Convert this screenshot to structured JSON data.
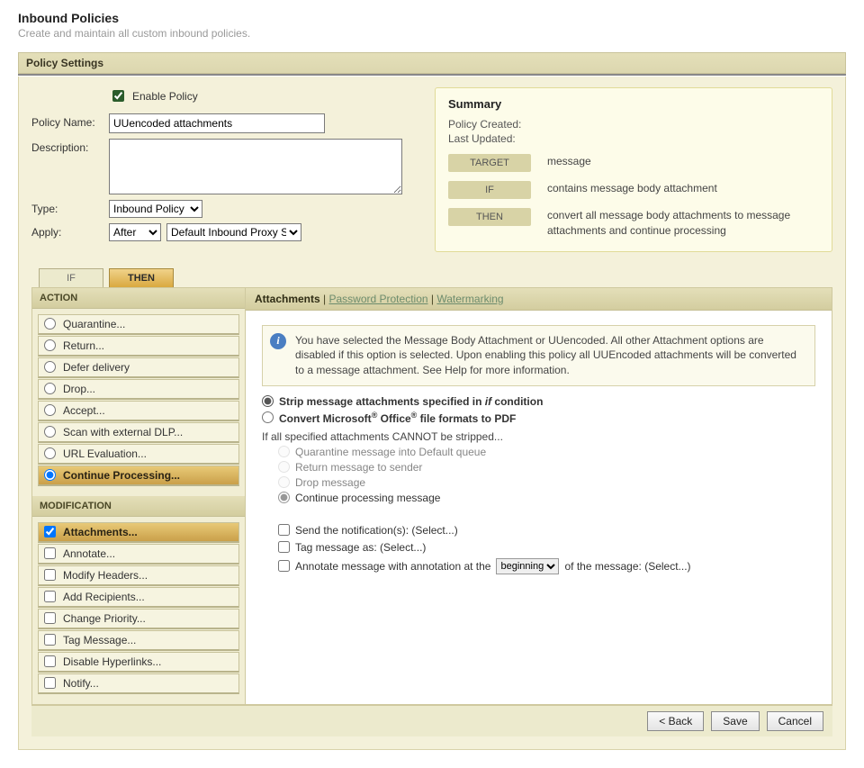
{
  "header": {
    "title": "Inbound Policies",
    "subtitle": "Create and maintain all custom inbound policies."
  },
  "settings": {
    "section_title": "Policy Settings",
    "enable_label": "Enable Policy",
    "enable_checked": true,
    "policy_name_label": "Policy Name:",
    "policy_name_value": "UUencoded attachments",
    "description_label": "Description:",
    "description_value": "",
    "type_label": "Type:",
    "type_options": [
      "Inbound Policy"
    ],
    "type_value": "Inbound Policy",
    "apply_label": "Apply:",
    "apply_when_value": "After",
    "apply_to_value": "Default Inbound Proxy S/M"
  },
  "summary": {
    "title": "Summary",
    "created_label": "Policy Created:",
    "updated_label": "Last Updated:",
    "target_pill": "TARGET",
    "target_value": "message",
    "if_pill": "IF",
    "if_value": "contains message body attachment",
    "then_pill": "THEN",
    "then_value": "convert all message body attachments to message attachments and continue processing"
  },
  "tabs": {
    "if": "IF",
    "then": "THEN"
  },
  "side": {
    "action_header": "ACTION",
    "mod_header": "MODIFICATION",
    "actions": [
      {
        "label": "Quarantine..."
      },
      {
        "label": "Return..."
      },
      {
        "label": "Defer delivery"
      },
      {
        "label": "Drop..."
      },
      {
        "label": "Accept..."
      },
      {
        "label": "Scan with external DLP..."
      },
      {
        "label": "URL Evaluation..."
      },
      {
        "label": "Continue Processing...",
        "selected": true
      }
    ],
    "mods": [
      {
        "label": "Attachments...",
        "selected": true
      },
      {
        "label": "Annotate..."
      },
      {
        "label": "Modify Headers..."
      },
      {
        "label": "Add Recipients..."
      },
      {
        "label": "Change Priority..."
      },
      {
        "label": "Tag Message..."
      },
      {
        "label": "Disable Hyperlinks..."
      },
      {
        "label": "Notify..."
      }
    ]
  },
  "content": {
    "nav_attachments": "Attachments",
    "nav_password": "Password Protection",
    "nav_watermark": "Watermarking",
    "info": "You have selected the Message Body Attachment or UUencoded. All other Attachment options are disabled if this option is selected. Upon enabling this policy all UUEncoded attachments will be converted to a message attachment. See Help for more information.",
    "strip_label_1": "Strip message attachments specified in ",
    "strip_label_if": "if",
    "strip_label_2": " condition",
    "convert_label_1": "Convert Microsoft",
    "convert_label_2": " Office",
    "convert_label_3": " file formats to PDF",
    "cannot_label": "If all specified attachments CANNOT be stripped...",
    "sub1": "Quarantine message into Default queue",
    "sub2": "Return message to sender",
    "sub3": "Drop message",
    "sub4": "Continue processing message",
    "chk_notify": "Send the notification(s): (Select...)",
    "chk_tag": "Tag message as: (Select...)",
    "chk_annotate_1": "Annotate message with annotation at the ",
    "chk_annotate_2": " of the message: (Select...)",
    "annotate_pos_value": "beginning"
  },
  "footer": {
    "back": "< Back",
    "save": "Save",
    "cancel": "Cancel"
  }
}
